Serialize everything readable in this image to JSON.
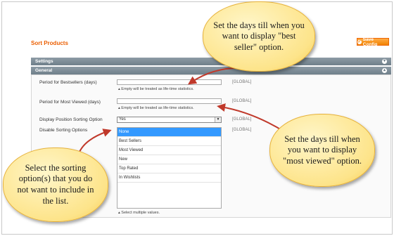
{
  "page": {
    "title": "Sort Products",
    "save_button": "Save Config"
  },
  "sections": {
    "settings": "Settings",
    "general": "General"
  },
  "fields": {
    "bestsellers_label": "Period for Bestsellers (days)",
    "bestsellers_note": "▴ Empty will be treated as life-time statistics.",
    "most_viewed_label": "Period for Most Viewed (days)",
    "most_viewed_note": "▴ Empty will be treated as life-time statistics.",
    "display_position_label": "Display Position Sorting Option",
    "display_position_value": "Yes",
    "disable_sorting_label": "Disable Sorting Options",
    "disable_sorting_options": [
      "None",
      "Best Sellers",
      "Most Viewed",
      "New",
      "Top Rated",
      "In Wishlists"
    ],
    "disable_sorting_selected": "None",
    "multiselect_note": "▴ Select multiple values.",
    "scope": "[GLOBAL]"
  },
  "callouts": {
    "best_seller": "Set the days till when you want to display \"best seller\" option.",
    "most_viewed": "Set the days till when you want to display \"most viewed\" option.",
    "sorting": "Select the sorting option(s) that you do not want to include in the list."
  },
  "colors": {
    "accent": "#eb5e00",
    "section_bar": "#7b8a95",
    "selection": "#3399ff",
    "callout_fill": "#fde48a",
    "arrow": "#c0392b"
  }
}
